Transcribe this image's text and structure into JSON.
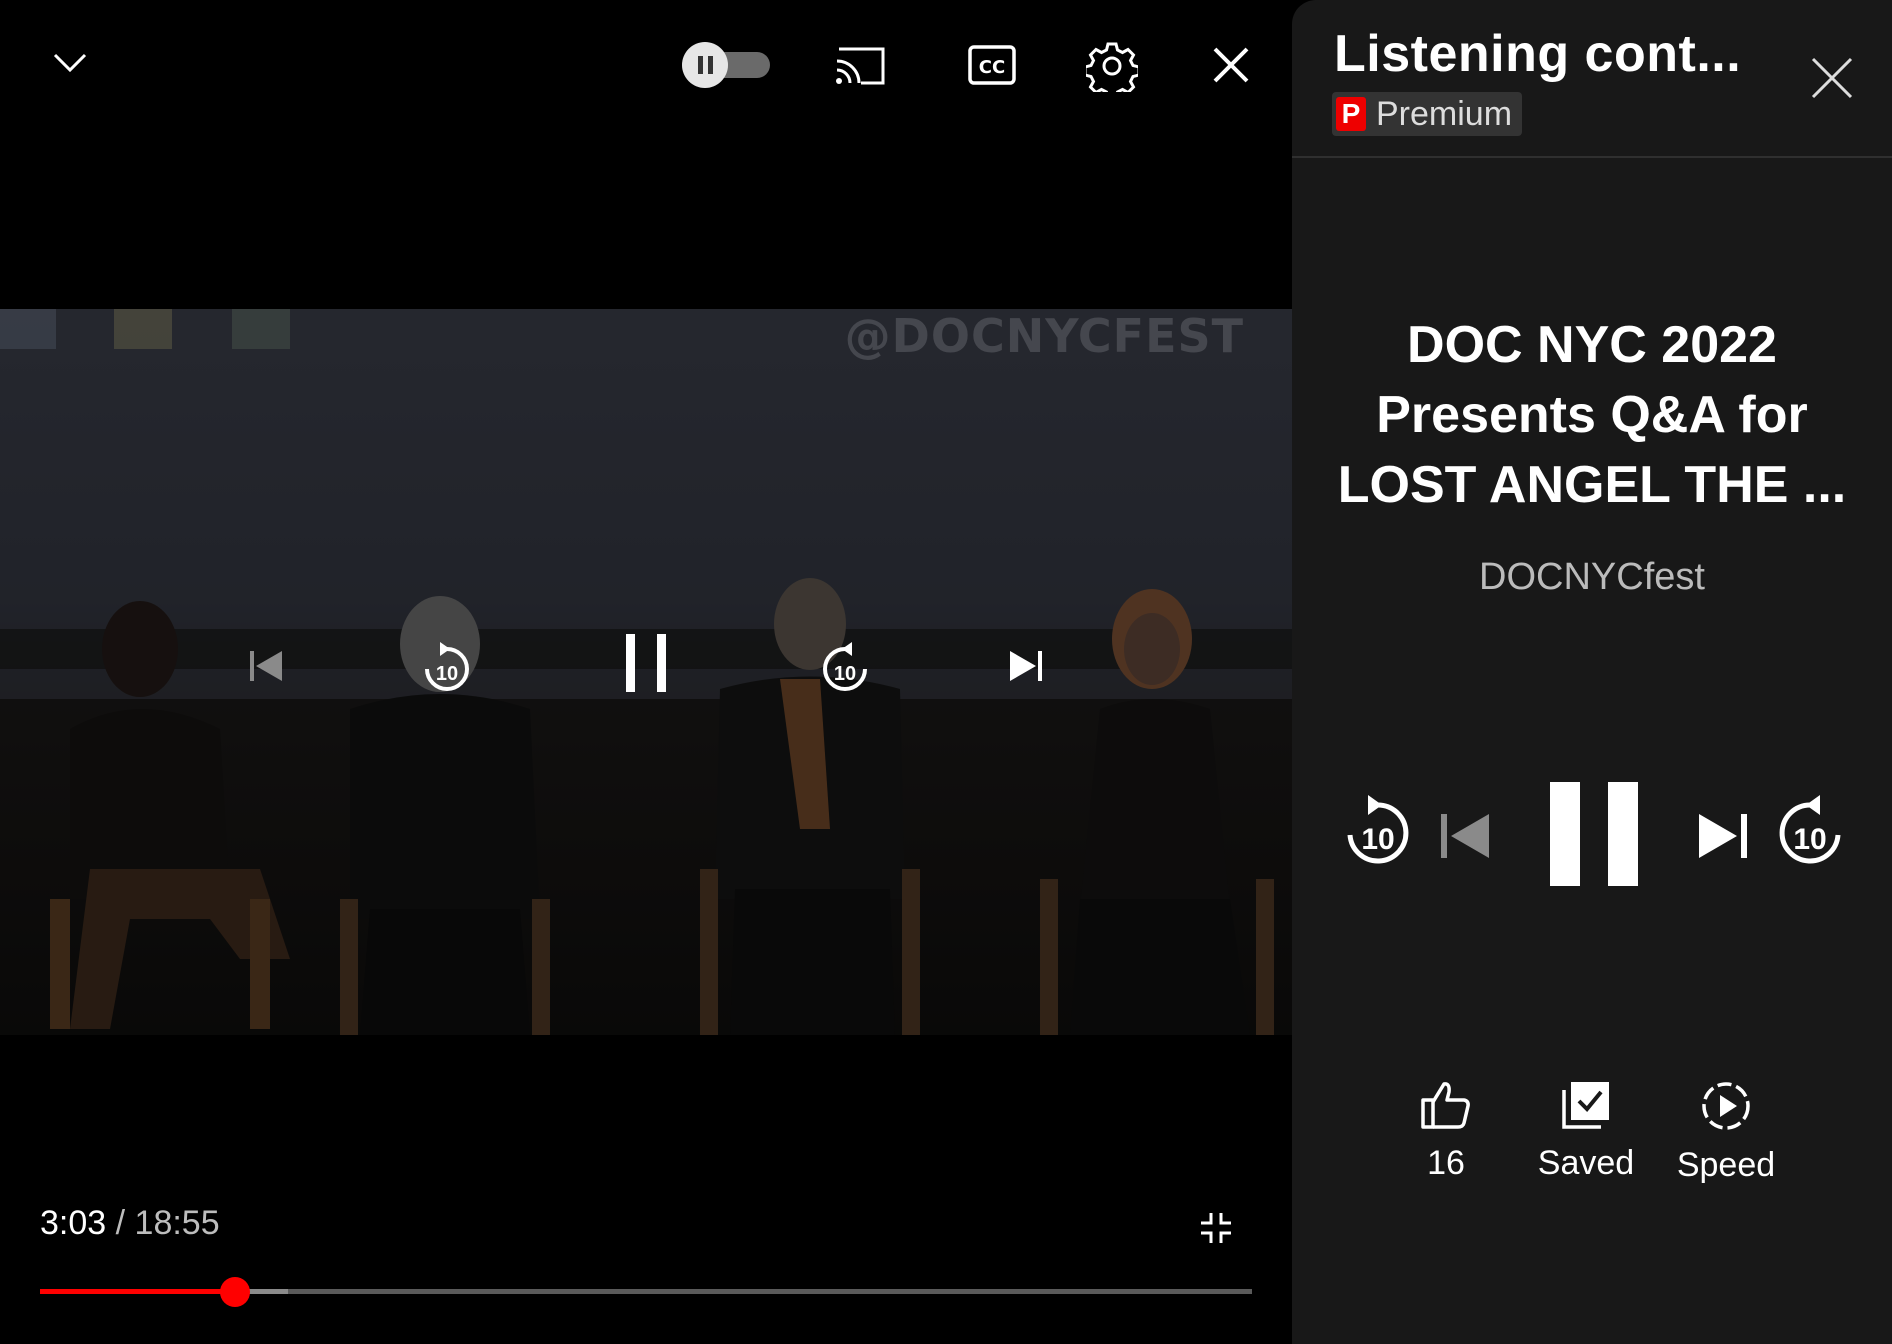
{
  "player": {
    "watermark": "@DOCNYCFEST",
    "current_time": "3:03",
    "separator": " / ",
    "duration": "18:55",
    "progress_fraction": 0.161,
    "buffer_fraction": 0.205,
    "icons": {
      "collapse": "chevron-down-icon",
      "autoplay": "autoplay-toggle",
      "cast": "cast-icon",
      "captions": "closed-captions-icon",
      "settings": "gear-icon",
      "close": "close-icon",
      "exit_fullscreen": "exit-fullscreen-icon"
    },
    "colors": {
      "progress": "#ff0000",
      "track": "#5a5a5a"
    }
  },
  "panel": {
    "title": "Listening cont...",
    "premium_badge_letter": "P",
    "premium_label": "Premium",
    "video_title_line1": "DOC NYC 2022",
    "video_title_line2": "Presents Q&A for",
    "video_title_line3": "LOST ANGEL THE ...",
    "channel": "DOCNYCfest",
    "seek_back_label": "10",
    "seek_fwd_label": "10",
    "actions": {
      "like_count": "16",
      "saved_label": "Saved",
      "speed_label": "Speed"
    }
  }
}
